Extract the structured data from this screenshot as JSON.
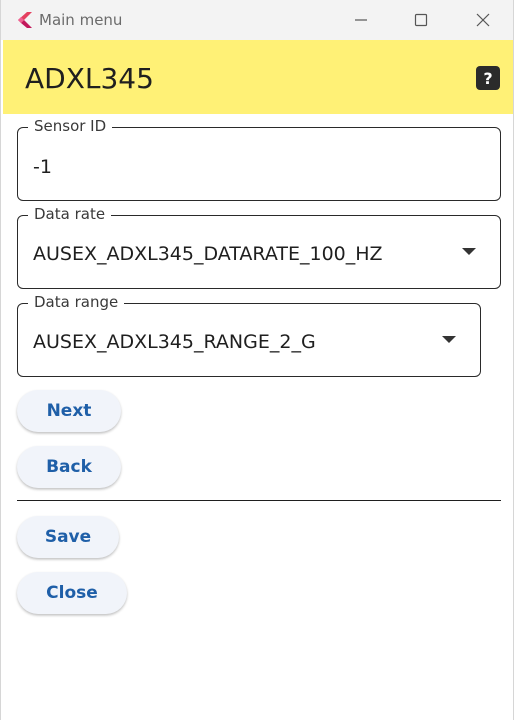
{
  "window": {
    "title": "Main menu",
    "icon": "flutter-logo-icon"
  },
  "appbar": {
    "title": "ADXL345",
    "help_label": "?"
  },
  "fields": {
    "sensor_id": {
      "label": "Sensor ID",
      "value": "-1"
    },
    "data_rate": {
      "label": "Data rate",
      "value": "AUSEX_ADXL345_DATARATE_100_HZ"
    },
    "data_range": {
      "label": "Data range",
      "value": "AUSEX_ADXL345_RANGE_2_G"
    }
  },
  "buttons": {
    "next": "Next",
    "back": "Back",
    "save": "Save",
    "close": "Close"
  },
  "colors": {
    "appbar_bg": "#fff176",
    "button_text": "#1f5fa8",
    "button_bg": "#f1f4fa"
  }
}
